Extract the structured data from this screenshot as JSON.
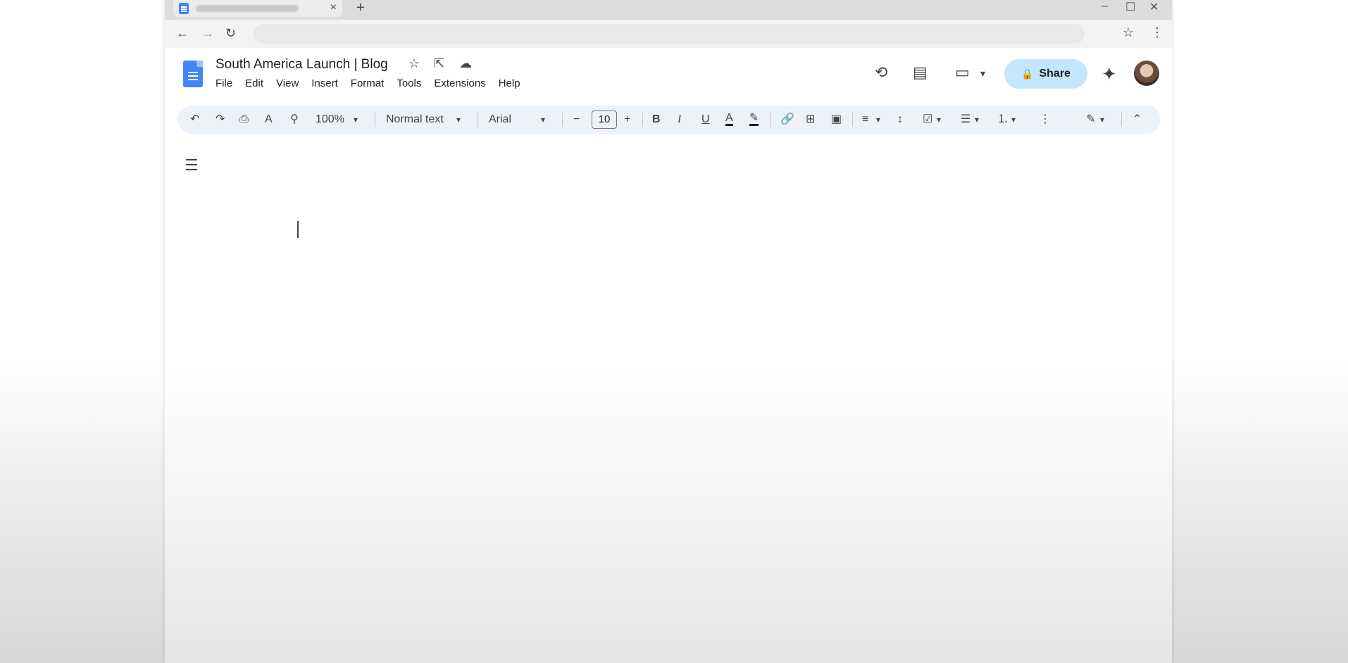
{
  "browser": {
    "tab_close": "×",
    "new_tab": "+",
    "win_min": "–",
    "win_max": "☐",
    "win_close": "✕",
    "back": "←",
    "forward": "→",
    "reload": "↻",
    "bookmark": "☆",
    "menu": "⋮"
  },
  "doc": {
    "title": "South America Launch | Blog",
    "star": "☆",
    "move": "⇱",
    "cloud": "☁"
  },
  "menubar": [
    "File",
    "Edit",
    "View",
    "Insert",
    "Format",
    "Tools",
    "Extensions",
    "Help"
  ],
  "header": {
    "history": "⟲",
    "comments": "▤",
    "meet": "▭",
    "meet_caret": "▾",
    "share_label": "Share",
    "lock": "🔒",
    "gemini": "✦"
  },
  "toolbar": {
    "undo": "↶",
    "redo": "↷",
    "print": "⎙",
    "spellcheck": "A",
    "paint": "⚲",
    "zoom": "100%",
    "style": "Normal text",
    "font": "Arial",
    "minus": "−",
    "font_size": "10",
    "plus": "+",
    "bold": "B",
    "italic": "I",
    "underline": "U",
    "text_color": "A",
    "highlight": "✎",
    "link": "🔗",
    "comment": "⊞",
    "image": "▣",
    "align": "≡",
    "line_spacing": "↕",
    "checklist": "☑",
    "bullets": "☰",
    "numbered": "⒈",
    "more": "⋮",
    "editing": "✎",
    "collapse": "⌃",
    "caret": "▾"
  },
  "outline": "☰"
}
